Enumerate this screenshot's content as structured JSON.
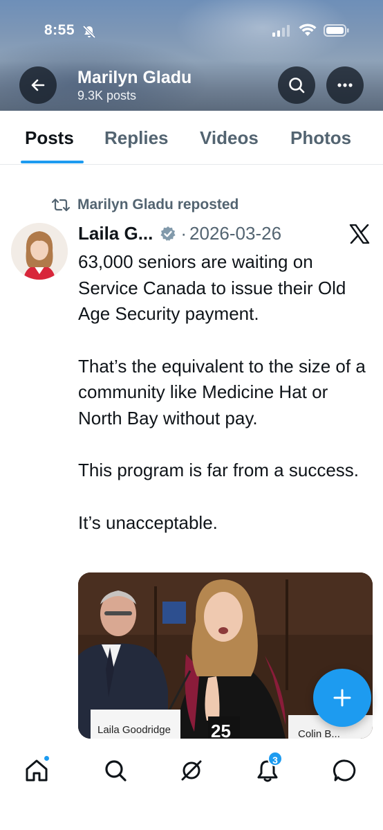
{
  "status": {
    "time": "8:55"
  },
  "header": {
    "profile_name": "Marilyn Gladu",
    "post_count": "9.3K posts"
  },
  "tabs": [
    {
      "label": "Posts",
      "active": true
    },
    {
      "label": "Replies",
      "active": false
    },
    {
      "label": "Videos",
      "active": false
    },
    {
      "label": "Photos",
      "active": false
    }
  ],
  "post": {
    "repost_text": "Marilyn Gladu reposted",
    "author": "Laila G...",
    "separator": "·",
    "date": "2026-03-26",
    "paragraphs": [
      "63,000 seniors are waiting on Service Canada to issue their Old Age Security payment.",
      "That’s the equivalent to the size of a community like Medicine Hat or North Bay without pay.",
      "This program is far from a success.",
      "It’s unacceptable."
    ],
    "media": {
      "nameplate_left": "Laila Goodridge",
      "nameplate_right": "Colin B...",
      "number": "25"
    }
  },
  "bottom_nav": {
    "notifications_badge": "3"
  },
  "colors": {
    "accent": "#1d9bf0",
    "text": "#0f1419",
    "muted": "#536471"
  }
}
